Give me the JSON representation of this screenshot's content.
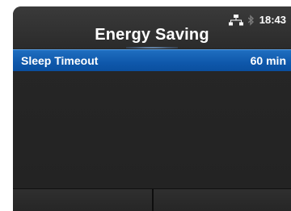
{
  "header": {
    "title": "Energy Saving",
    "time": "18:43"
  },
  "status_icons": [
    "network-icon",
    "bluetooth-icon"
  ],
  "menu": {
    "items": [
      {
        "label": "Sleep Timeout",
        "value": "60 min",
        "selected": true
      }
    ]
  },
  "softkeys": {
    "left_label": "",
    "right_label": ""
  },
  "colors": {
    "accent": "#0f58ab",
    "background": "#262626",
    "text": "#ffffff"
  }
}
